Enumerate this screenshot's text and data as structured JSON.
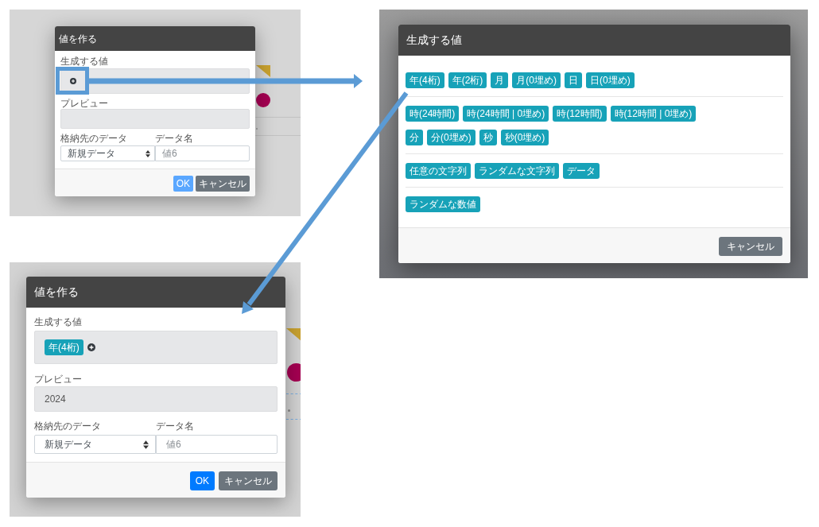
{
  "panels": [
    {
      "kind": "create_value",
      "title": "値を作る",
      "generated_label": "生成する値",
      "add_button": {
        "highlighted": true
      },
      "preview_label": "プレビュー",
      "storage_label": "格納先のデータ",
      "storage_value": "新規データ",
      "name_label": "データ名",
      "name_placeholder": "値6",
      "buttons": [
        {
          "label": "OK",
          "kind": "primary",
          "disabled": true
        },
        {
          "label": "キャンセル",
          "kind": "secondary",
          "disabled": false
        }
      ]
    },
    {
      "kind": "value_picker",
      "title": "生成する値",
      "groups": [
        {
          "lines": [
            {
              "chips": [
                "年(4桁)",
                "年(2桁)",
                "月",
                "月(0埋め)",
                "日",
                "日(0埋め)"
              ]
            }
          ]
        },
        {
          "lines": [
            {
              "chips": [
                "時(24時間)",
                "時(24時間 | 0埋め)",
                "時(12時間)",
                "時(12時間 | 0埋め)"
              ]
            },
            {
              "chips": [
                "分",
                "分(0埋め)",
                "秒",
                "秒(0埋め)"
              ]
            }
          ]
        },
        {
          "lines": [
            {
              "chips": [
                "任意の文字列",
                "ランダムな文字列",
                "データ"
              ]
            }
          ]
        },
        {
          "lines": [
            {
              "chips": [
                "ランダムな数値"
              ]
            }
          ]
        }
      ],
      "buttons": [
        {
          "label": "キャンセル",
          "kind": "secondary",
          "disabled": false
        }
      ]
    },
    {
      "kind": "create_value",
      "title": "値を作る",
      "generated_label": "生成する値",
      "chips": [
        "年(4桁)"
      ],
      "add_button": {
        "highlighted": false
      },
      "preview_label": "プレビュー",
      "preview_value": "2024",
      "storage_label": "格納先のデータ",
      "storage_value": "新規データ",
      "name_label": "データ名",
      "name_placeholder": "値6",
      "buttons": [
        {
          "label": "OK",
          "kind": "primary",
          "disabled": false
        },
        {
          "label": "キャンセル",
          "kind": "secondary",
          "disabled": false
        }
      ]
    }
  ]
}
